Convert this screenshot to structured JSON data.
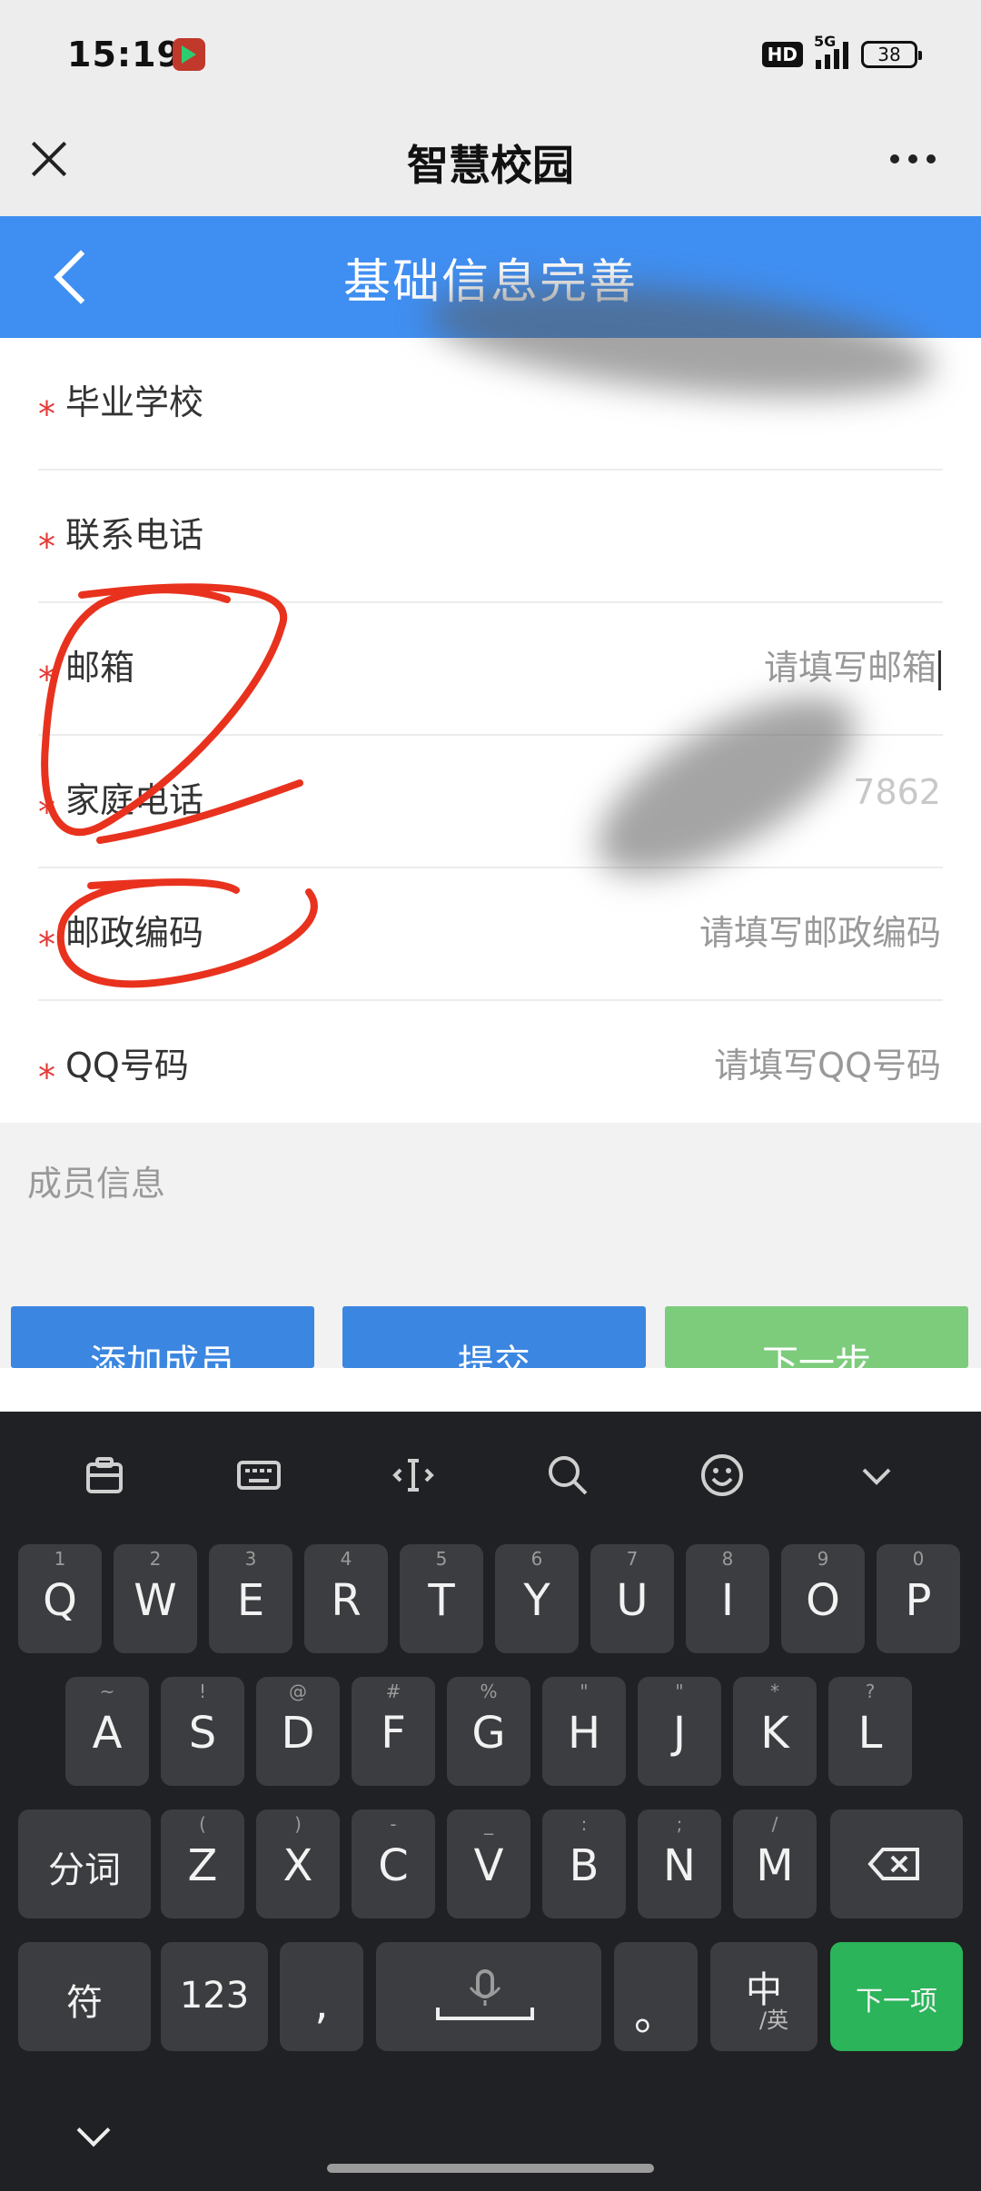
{
  "status_bar": {
    "time": "15:19",
    "hd": "HD",
    "network": "5G",
    "battery": "38"
  },
  "top_bar": {
    "title": "智慧校园"
  },
  "header": {
    "title": "基础信息完善"
  },
  "form": {
    "fields": [
      {
        "label": "毕业学校",
        "value": ""
      },
      {
        "label": "联系电话",
        "value": ""
      },
      {
        "label": "邮箱",
        "placeholder": "请填写邮箱"
      },
      {
        "label": "家庭电话",
        "value": "7862"
      },
      {
        "label": "邮政编码",
        "placeholder": "请填写邮政编码"
      },
      {
        "label": "QQ号码",
        "placeholder": "请填写QQ号码"
      }
    ],
    "required_mark": "*"
  },
  "members": {
    "section_label": "成员信息",
    "add_button": "添加成员",
    "submit_button": "提交",
    "next_button": "下一步"
  },
  "keyboard": {
    "toolbar_icons": [
      "clipboard-icon",
      "keyboard-icon",
      "cursor-icon",
      "search-icon",
      "emoji-icon",
      "collapse-icon"
    ],
    "row1": [
      {
        "k": "Q",
        "s": "1"
      },
      {
        "k": "W",
        "s": "2"
      },
      {
        "k": "E",
        "s": "3"
      },
      {
        "k": "R",
        "s": "4"
      },
      {
        "k": "T",
        "s": "5"
      },
      {
        "k": "Y",
        "s": "6"
      },
      {
        "k": "U",
        "s": "7"
      },
      {
        "k": "I",
        "s": "8"
      },
      {
        "k": "O",
        "s": "9"
      },
      {
        "k": "P",
        "s": "0"
      }
    ],
    "row2": [
      {
        "k": "A",
        "s": "~"
      },
      {
        "k": "S",
        "s": "!"
      },
      {
        "k": "D",
        "s": "@"
      },
      {
        "k": "F",
        "s": "#"
      },
      {
        "k": "G",
        "s": "%"
      },
      {
        "k": "H",
        "s": "\""
      },
      {
        "k": "J",
        "s": "\""
      },
      {
        "k": "K",
        "s": "*"
      },
      {
        "k": "L",
        "s": "?"
      }
    ],
    "row3": [
      {
        "k": "Z",
        "s": "("
      },
      {
        "k": "X",
        "s": ")"
      },
      {
        "k": "C",
        "s": "-"
      },
      {
        "k": "V",
        "s": "_"
      },
      {
        "k": "B",
        "s": ":"
      },
      {
        "k": "N",
        "s": ";"
      },
      {
        "k": "M",
        "s": "/"
      }
    ],
    "fenci": "分词",
    "symbol": "符",
    "num": "123",
    "comma": ",",
    "period": "。",
    "lang_main": "中",
    "lang_sub": "/英",
    "next_item": "下一项"
  }
}
